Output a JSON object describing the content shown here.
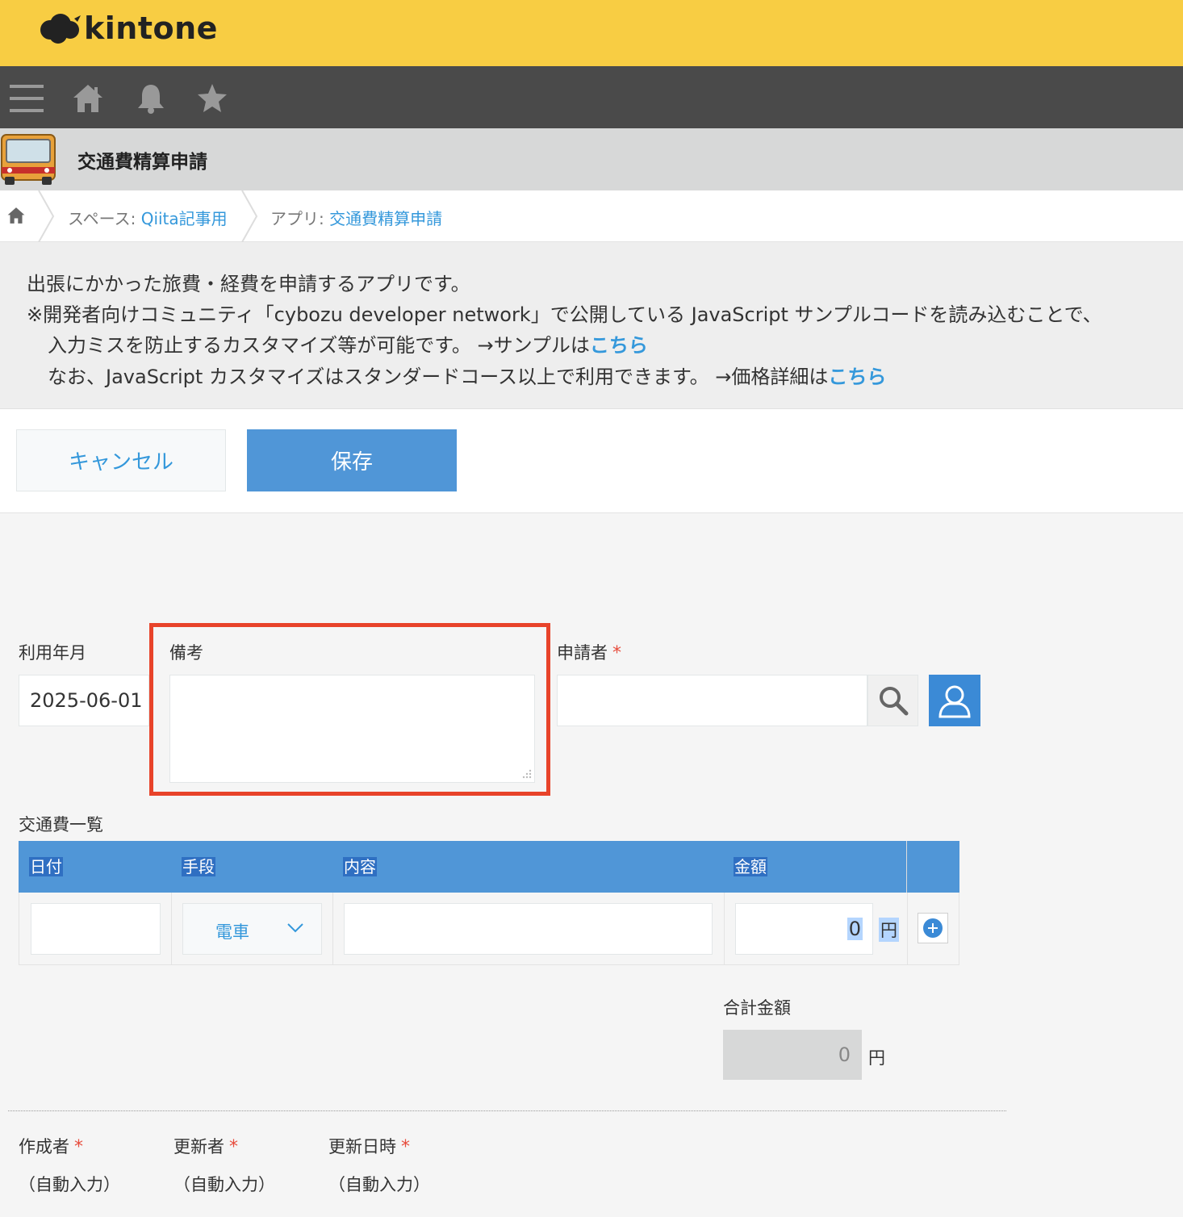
{
  "brand": {
    "logo_text": "kintone"
  },
  "app": {
    "title": "交通費精算申請"
  },
  "breadcrumb": {
    "space_prefix": "スペース: ",
    "space_name": "Qiita記事用",
    "app_prefix": "アプリ: ",
    "app_name": "交通費精算申請"
  },
  "description": {
    "line1": "出張にかかった旅費・経費を申請するアプリです。",
    "line2": "※開発者向けコミュニティ「cybozu developer network」で公開している JavaScript サンプルコードを読み込むことで、",
    "line3": "入力ミスを防止するカスタマイズ等が可能です。 →サンプルは",
    "line3_link": "こちら",
    "line4": "なお、JavaScript カスタマイズはスタンダードコース以上で利用できます。 →価格詳細は",
    "line4_link": "こちら"
  },
  "actions": {
    "cancel_label": "キャンセル",
    "save_label": "保存"
  },
  "form": {
    "usage_month_label": "利用年月",
    "usage_month_value": "2025-06-01",
    "notes_label": "備考",
    "applicant_label": "申請者",
    "required_mark": "*",
    "table_label": "交通費一覧",
    "table": {
      "headers": [
        "日付",
        "手段",
        "内容",
        "金額"
      ],
      "row": {
        "method": "電車",
        "amount": "0",
        "unit": "円"
      }
    },
    "total_label": "合計金額",
    "total_value": "0",
    "total_unit": "円",
    "creator_label": "作成者",
    "updater_label": "更新者",
    "updated_at_label": "更新日時",
    "auto_input": "（自動入力）"
  },
  "colors": {
    "topbar": "#f8cd43",
    "accent": "#5096d7",
    "link": "#3498db",
    "highlight": "#e8432a"
  },
  "icons": [
    "cloud-logo-icon",
    "menu-icon",
    "home-icon",
    "bell-icon",
    "star-icon",
    "bus-icon",
    "search-icon",
    "user-icon",
    "plus-icon",
    "chevron-down-icon"
  ]
}
